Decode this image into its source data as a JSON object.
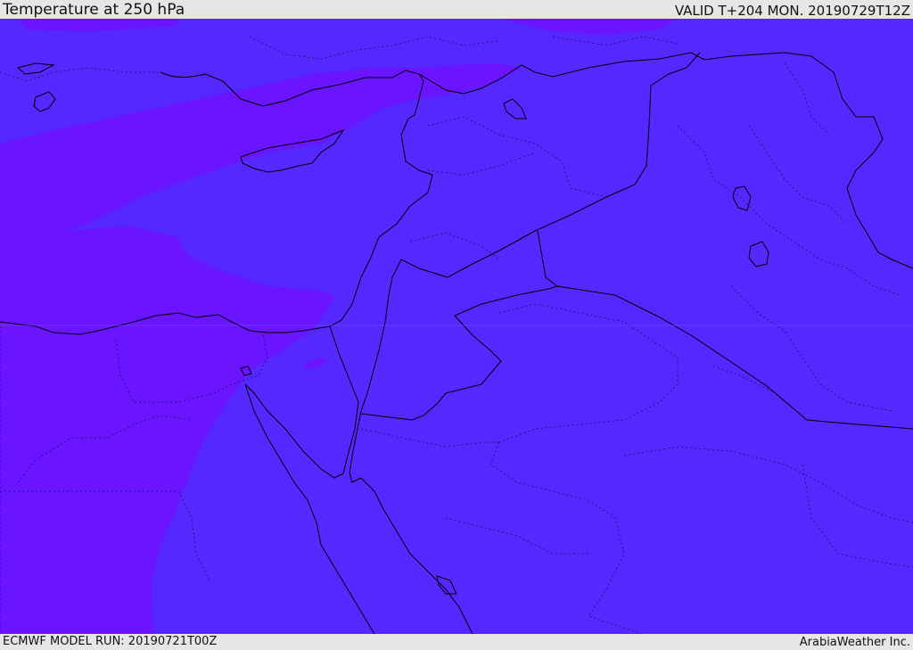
{
  "header": {
    "title": "Temperature at 250 hPa",
    "valid": "VALID T+204 MON. 20190729T12Z"
  },
  "footer": {
    "model_run": "ECMWF MODEL RUN: 20190721T00Z",
    "credit": "ArabiaWeather Inc."
  },
  "colors": {
    "field_base": "#5528ff",
    "field_cold": "#6b14ff",
    "coastline": "#000000",
    "border_dotted": "#1a1060",
    "bar_bg": "#e6e6e6"
  }
}
